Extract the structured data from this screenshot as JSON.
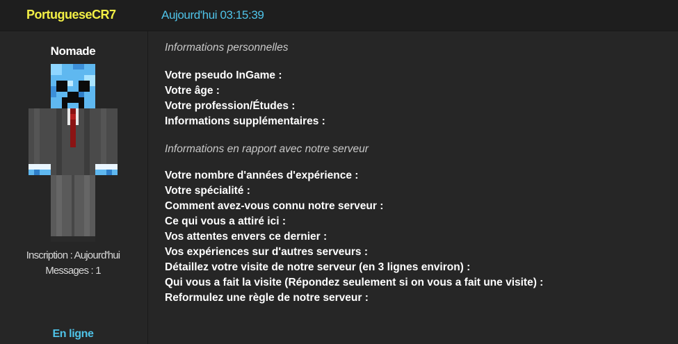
{
  "post": {
    "author": "PortugueseCR7",
    "date": "Aujourd'hui 03:15:39"
  },
  "profile": {
    "rank": "Nomade",
    "inscription": "Inscription : Aujourd'hui",
    "messages": "Messages : 1",
    "status": "En ligne",
    "avatar_icon": "minecraft-skin-avatar"
  },
  "body": {
    "section1_title": "Informations personnelles",
    "section1_lines": [
      "Votre pseudo InGame :",
      "Votre âge :",
      "Votre profession/Études :",
      "Informations supplémentaires :"
    ],
    "section2_title": "Informations en rapport avec notre serveur",
    "section2_lines": [
      "Votre nombre d'années d'expérience :",
      "Votre spécialité :",
      "Comment avez-vous connu notre serveur :",
      "Ce qui vous a attiré ici :",
      "Vos attentes envers ce dernier :",
      "Vos expériences sur d'autres serveurs :",
      "Détaillez votre visite de notre serveur (en 3 lignes environ) :",
      "Qui vous a fait la visite (Répondez seulement si on vous a fait une visite) :",
      "Reformulez une règle de notre serveur :"
    ]
  },
  "colors": {
    "author": "#f2ef45",
    "date": "#4fc3e8",
    "online": "#4fc3e8",
    "background": "#262626",
    "header": "#1e1e1e"
  }
}
